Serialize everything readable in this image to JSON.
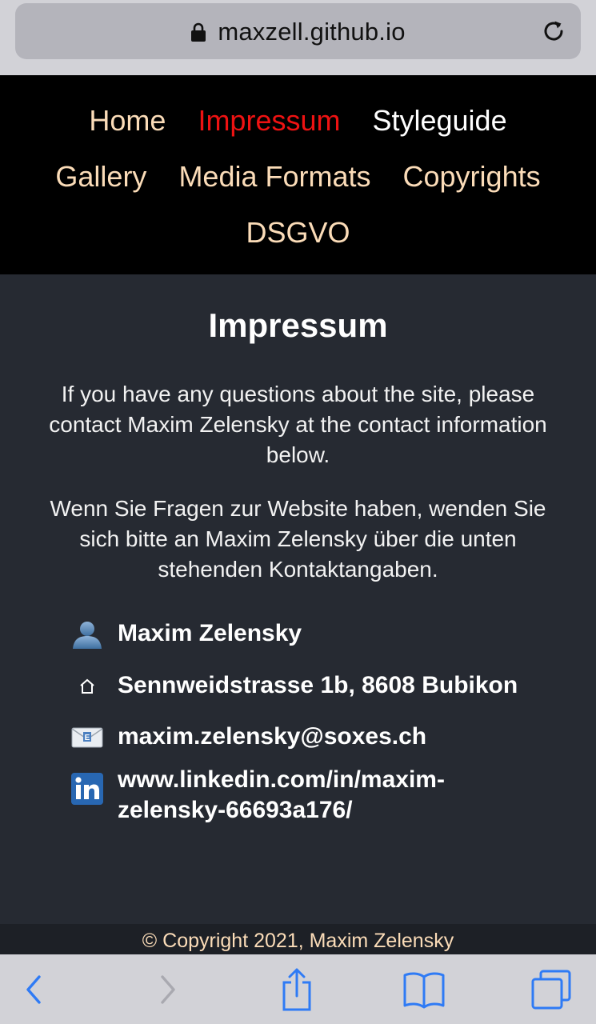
{
  "browser": {
    "url": "maxzell.github.io"
  },
  "nav": {
    "items": [
      {
        "label": "Home"
      },
      {
        "label": "Impressum"
      },
      {
        "label": "Styleguide"
      },
      {
        "label": "Gallery"
      },
      {
        "label": "Media Formats"
      },
      {
        "label": "Copyrights"
      },
      {
        "label": "DSGVO"
      }
    ]
  },
  "main": {
    "title": "Impressum",
    "paragraphs": [
      "If you have any questions about the site, please contact Maxim Zelensky at the contact information below.",
      "Wenn Sie Fragen zur Website haben, wenden Sie sich bitte an Maxim Zelensky über die unten stehenden Kontaktangaben."
    ],
    "contacts": [
      {
        "icon": "person-icon",
        "text": "Maxim Zelensky"
      },
      {
        "icon": "house-icon",
        "text": "Sennweidstrasse 1b, 8608 Bubikon"
      },
      {
        "icon": "envelope-icon",
        "text": "maxim.zelensky@soxes.ch"
      },
      {
        "icon": "linkedin-icon",
        "text": "www.linkedin.com/in/maxim-zelensky-66693a176/"
      }
    ]
  },
  "footer": {
    "text": "© Copyright 2021, Maxim Zelensky"
  },
  "colors": {
    "nav_link": "#fbdcb8",
    "nav_active": "#ee1212",
    "page_bg": "#262a32",
    "toolbar_accent": "#2f7bf5"
  }
}
